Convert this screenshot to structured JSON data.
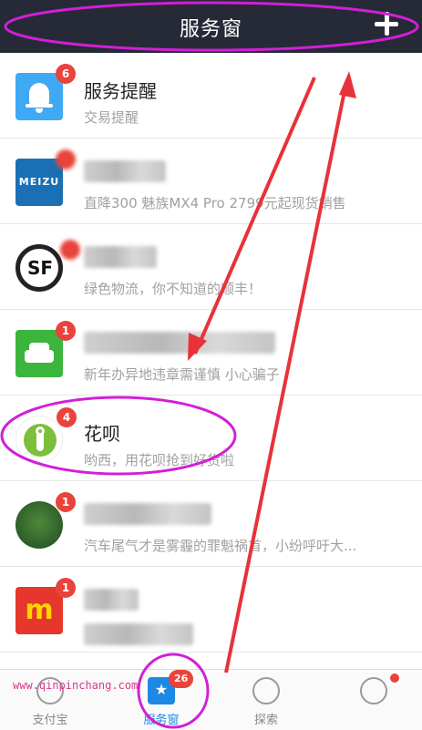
{
  "header": {
    "title": "服务窗",
    "add_icon": "plus-icon"
  },
  "list": [
    {
      "title": "服务提醒",
      "subtitle": "交易提醒",
      "badge": "6",
      "icon": "bell-icon"
    },
    {
      "title": "",
      "subtitle": "直降300 魅族MX4 Pro 2799元起现货销售",
      "badge": "",
      "icon": "meizu-logo"
    },
    {
      "title": "",
      "subtitle": "绿色物流，你不知道的顺丰！",
      "badge": "",
      "icon": "sf-logo"
    },
    {
      "title": "",
      "subtitle": "新年办异地违章需谨慎 小心骗子",
      "badge": "1",
      "icon": "car-icon"
    },
    {
      "title": "花呗",
      "subtitle": "哟西，用花呗抢到好货啦",
      "badge": "4",
      "icon": "huabei-logo"
    },
    {
      "title": "",
      "subtitle": "汽车尾气才是雾霾的罪魁祸首，小纷呼吁大...",
      "badge": "1",
      "icon": "green-logo"
    },
    {
      "title": "",
      "subtitle": "",
      "badge": "1",
      "icon": "m-logo"
    }
  ],
  "tabs": [
    {
      "label": "支付宝",
      "icon": "alipay-icon"
    },
    {
      "label": "服务窗",
      "icon": "service-window-icon",
      "badge": "26",
      "active": true
    },
    {
      "label": "探索",
      "icon": "explore-icon"
    },
    {
      "label": "",
      "icon": "me-icon"
    }
  ],
  "watermark": "www.qinpinchang.com",
  "annotation_color": "#d21fd6",
  "arrow_color": "#e8323a"
}
